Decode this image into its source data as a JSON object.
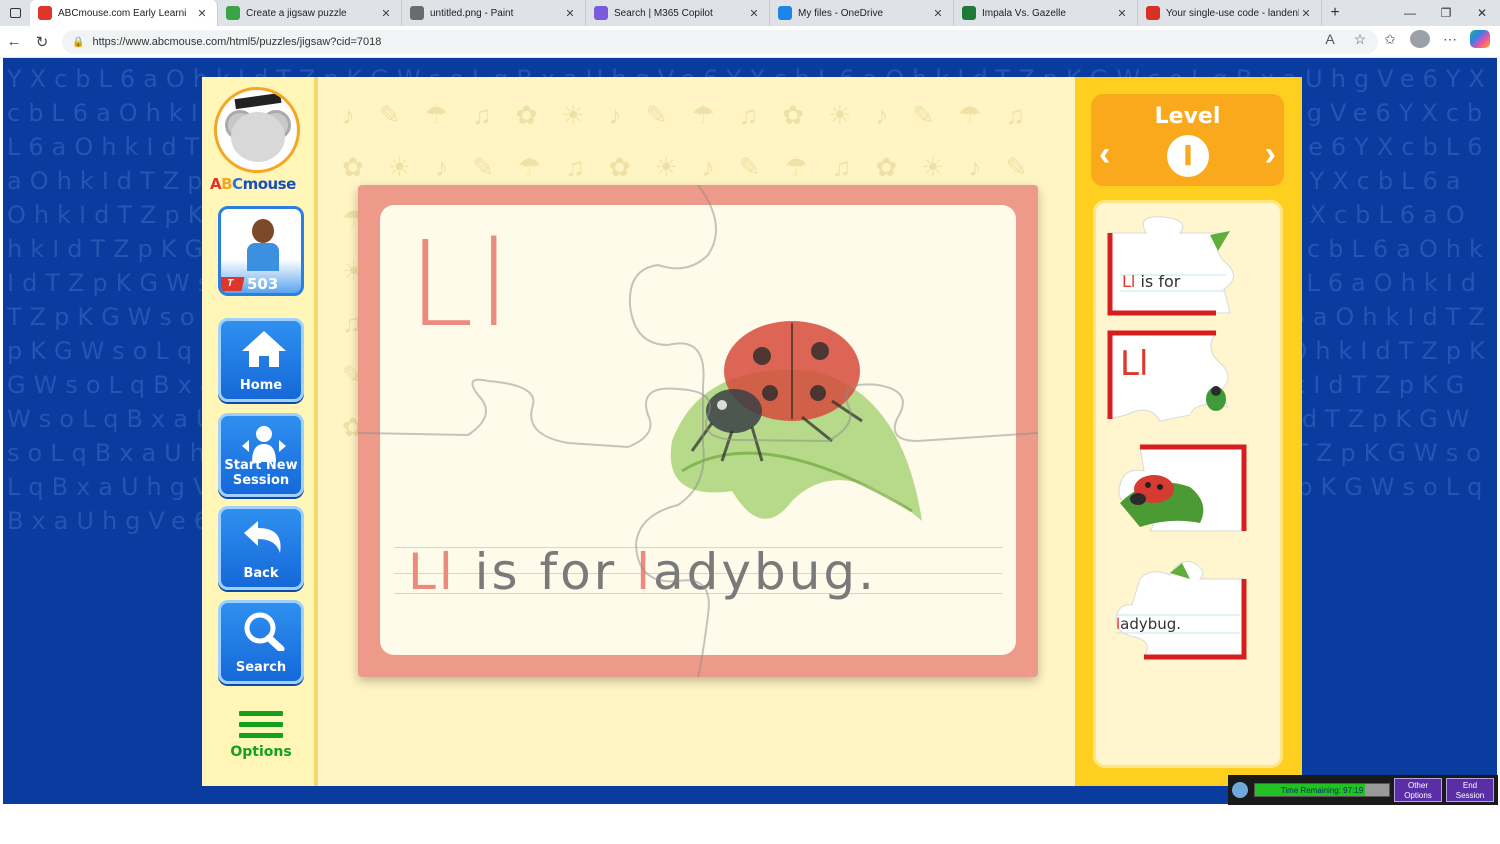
{
  "browser": {
    "tabs": [
      {
        "title": "ABCmouse.com Early Learni",
        "active": true,
        "icon_color": "#e0352b"
      },
      {
        "title": "Create a jigsaw puzzle",
        "active": false,
        "icon_color": "#3aa548"
      },
      {
        "title": "untitled.png - Paint",
        "active": false,
        "icon_color": "#6b6b6b"
      },
      {
        "title": "Search | M365 Copilot",
        "active": false,
        "icon_color": "#7a5be0"
      },
      {
        "title": "My files - OneDrive",
        "active": false,
        "icon_color": "#1c86e8"
      },
      {
        "title": "Impala Vs. Gazelle",
        "active": false,
        "icon_color": "#1f7a3a"
      },
      {
        "title": "Your single-use code - landenka",
        "active": false,
        "icon_color": "#d93025"
      }
    ],
    "url": "https://www.abcmouse.com/html5/puzzles/jigsaw?cid=7018"
  },
  "sidebar": {
    "logo_text": {
      "a": "A",
      "b": "B",
      "c": "C",
      "m": "mouse"
    },
    "ticket_label": "T",
    "points": "503",
    "home_label": "Home",
    "start_label_1": "Start New",
    "start_label_2": "Session",
    "back_label": "Back",
    "search_label": "Search",
    "options_label": "Options"
  },
  "card": {
    "letter": "Ll",
    "sentence_red_1": "Ll",
    "sentence_mid": " is for ",
    "sentence_red_2": "l",
    "sentence_end": "adybug."
  },
  "level": {
    "title": "Level",
    "number": "I",
    "prev": "‹",
    "next": "›"
  },
  "pieces": [
    {
      "text_red": "Ll",
      "text": " is for "
    },
    {
      "text_red": "Ll",
      "text": ""
    },
    {
      "text_red": "",
      "text": ""
    },
    {
      "text_red": "l",
      "text": "adybug."
    }
  ],
  "timer": {
    "label": "Time Remaining: 97:19",
    "fill_fraction": 0.82,
    "other_1": "Other",
    "other_2": "Options",
    "end_1": "End",
    "end_2": "Session"
  },
  "colors": {
    "page_bg": "#0a3b9e",
    "accent_blue": "#1668d8",
    "level_orange": "#f9a91b",
    "panel_yellow": "#ffcf20",
    "letter_pink": "#ec8a7e"
  }
}
